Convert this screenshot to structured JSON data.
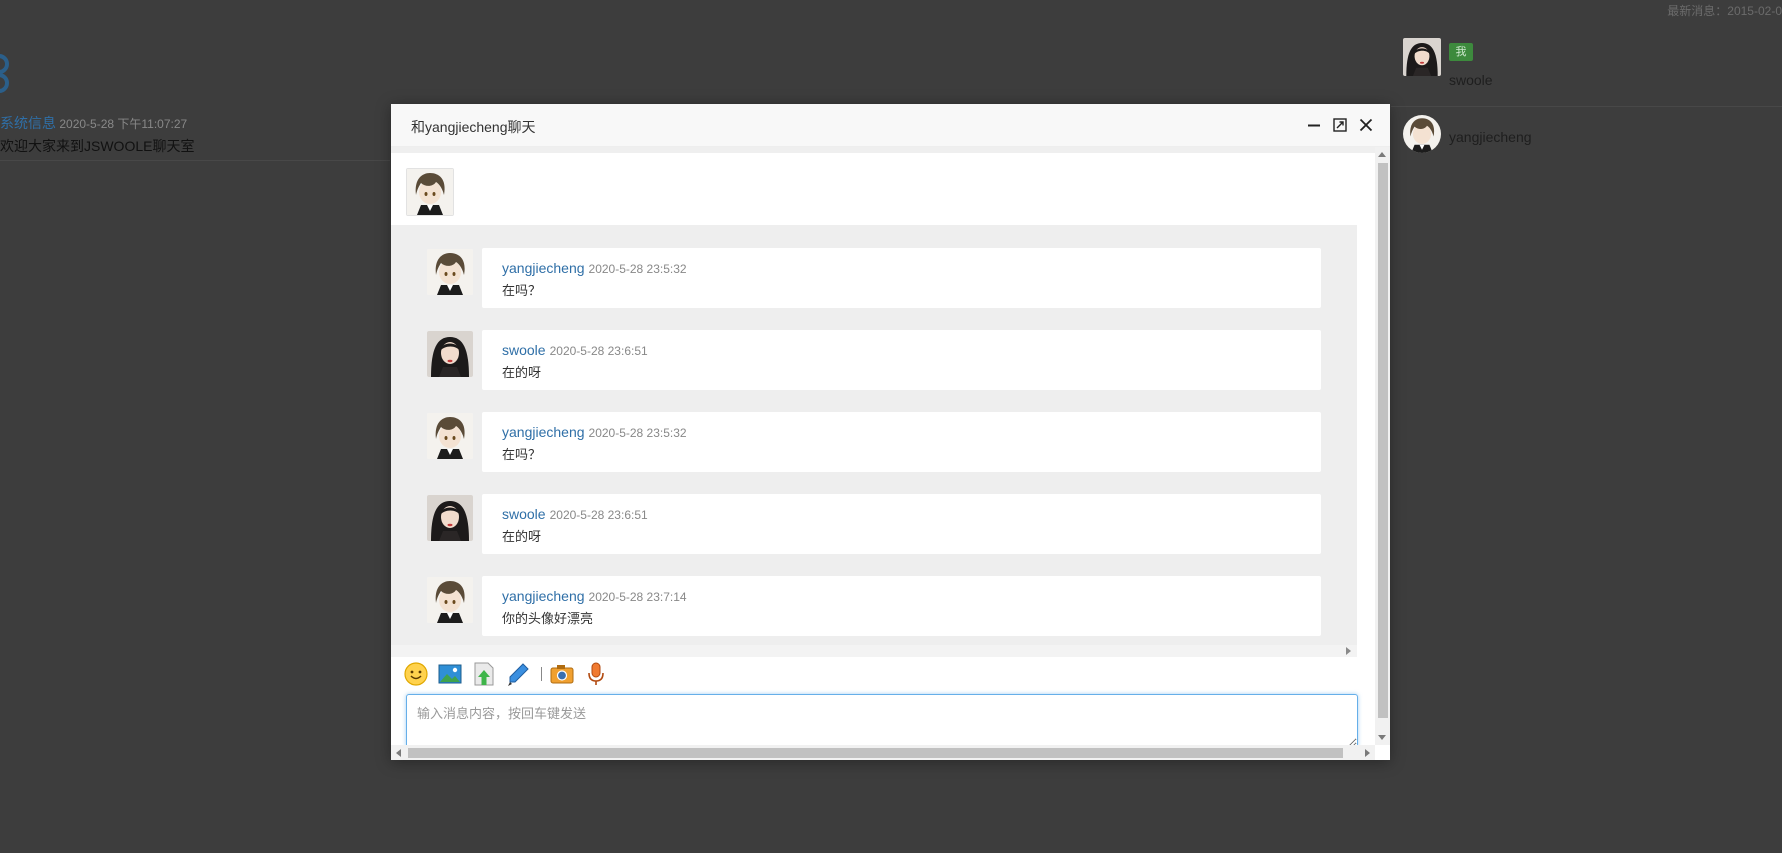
{
  "background": {
    "latest_notice": "最新消息：2015-02-0",
    "system_message": {
      "sender": "系统信息",
      "time": "2020-5-28 下午11:07:27",
      "text": "欢迎大家来到JSWOOLE聊天室"
    },
    "users": [
      {
        "name": "swoole",
        "badge": "我"
      },
      {
        "name": "yangjiecheng"
      }
    ]
  },
  "dialog": {
    "title": "和yangjiecheng聊天",
    "window_buttons": [
      "minimize-icon",
      "maximize-icon",
      "close-icon"
    ],
    "messages": [
      {
        "sender": "yangjiecheng",
        "time": "2020-5-28 23:5:32",
        "text": "在吗？",
        "avatar": "boy-avatar"
      },
      {
        "sender": "swoole",
        "time": "2020-5-28 23:6:51",
        "text": "在的呀",
        "avatar": "girl-avatar"
      },
      {
        "sender": "yangjiecheng",
        "time": "2020-5-28 23:5:32",
        "text": "在吗？",
        "avatar": "boy-avatar"
      },
      {
        "sender": "swoole",
        "time": "2020-5-28 23:6:51",
        "text": "在的呀",
        "avatar": "girl-avatar"
      },
      {
        "sender": "yangjiecheng",
        "time": "2020-5-28 23:7:14",
        "text": "你的头像好漂亮",
        "avatar": "boy-avatar"
      }
    ],
    "toolbar": [
      "smiley-icon",
      "image-icon",
      "upload-file-icon",
      "pen-icon",
      "camera-icon",
      "microphone-icon"
    ],
    "input": {
      "placeholder": "输入消息内容，按回车键发送",
      "value": ""
    }
  },
  "colors": {
    "overlay": "#3d3d3d",
    "link_blue": "#2f6fa7",
    "message_area": "#eeeeee",
    "input_focus": "#66afe9"
  }
}
